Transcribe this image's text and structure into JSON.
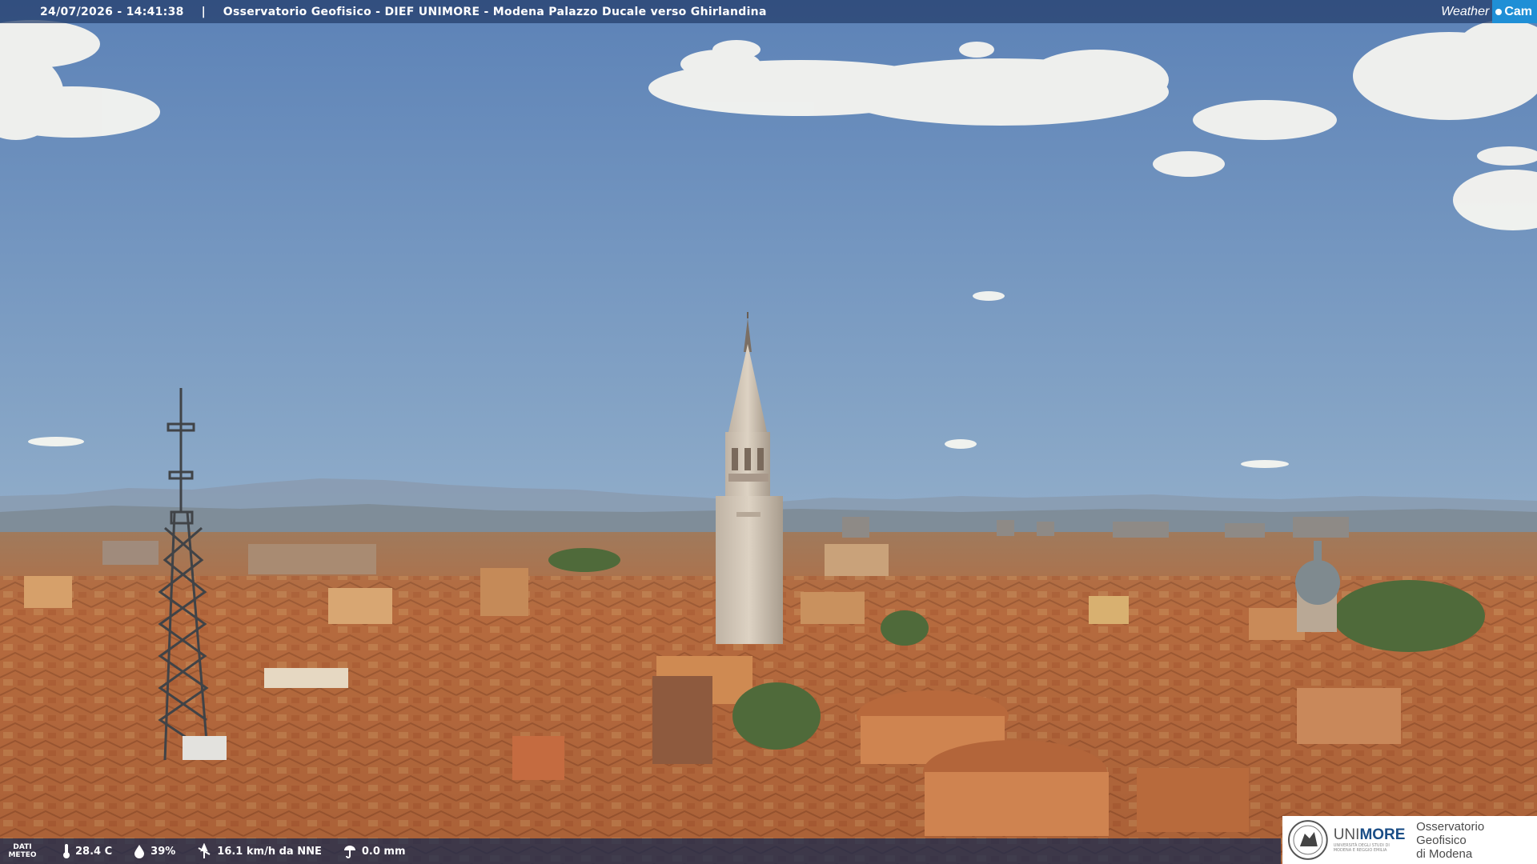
{
  "header": {
    "timestamp": "24/07/2026 - 14:41:38",
    "separator": "|",
    "title": "Osservatorio Geofisico - DIEF UNIMORE - Modena Palazzo Ducale verso Ghirlandina"
  },
  "brand": {
    "weather": "Weather",
    "cam": "Cam"
  },
  "weather_bar": {
    "label_line1": "DATI",
    "label_line2": "METEO",
    "temperature": "28.4 C",
    "humidity": "39%",
    "wind": "16.1 km/h da NNE",
    "rain": "0.0 mm"
  },
  "logo": {
    "uni_prefix": "UNI",
    "uni_suffix": "MORE",
    "uni_sub_line1": "UNIVERSITÀ DEGLI STUDI DI",
    "uni_sub_line2": "MODENA E REGGIO EMILIA",
    "observatory_line1": "Osservatorio Geofisico",
    "observatory_line2": "di Modena"
  },
  "colors": {
    "sky_top": "#5d84b9",
    "sky_horizon": "#b6c8d6",
    "roof": "#b86a3e",
    "wall": "#d9a46e",
    "tower": "#d8ccbc",
    "cam_blue": "#1f8fd6"
  },
  "icons": [
    "thermometer-icon",
    "humidity-drop-icon",
    "wind-icon",
    "rain-icon",
    "university-seal-icon"
  ]
}
